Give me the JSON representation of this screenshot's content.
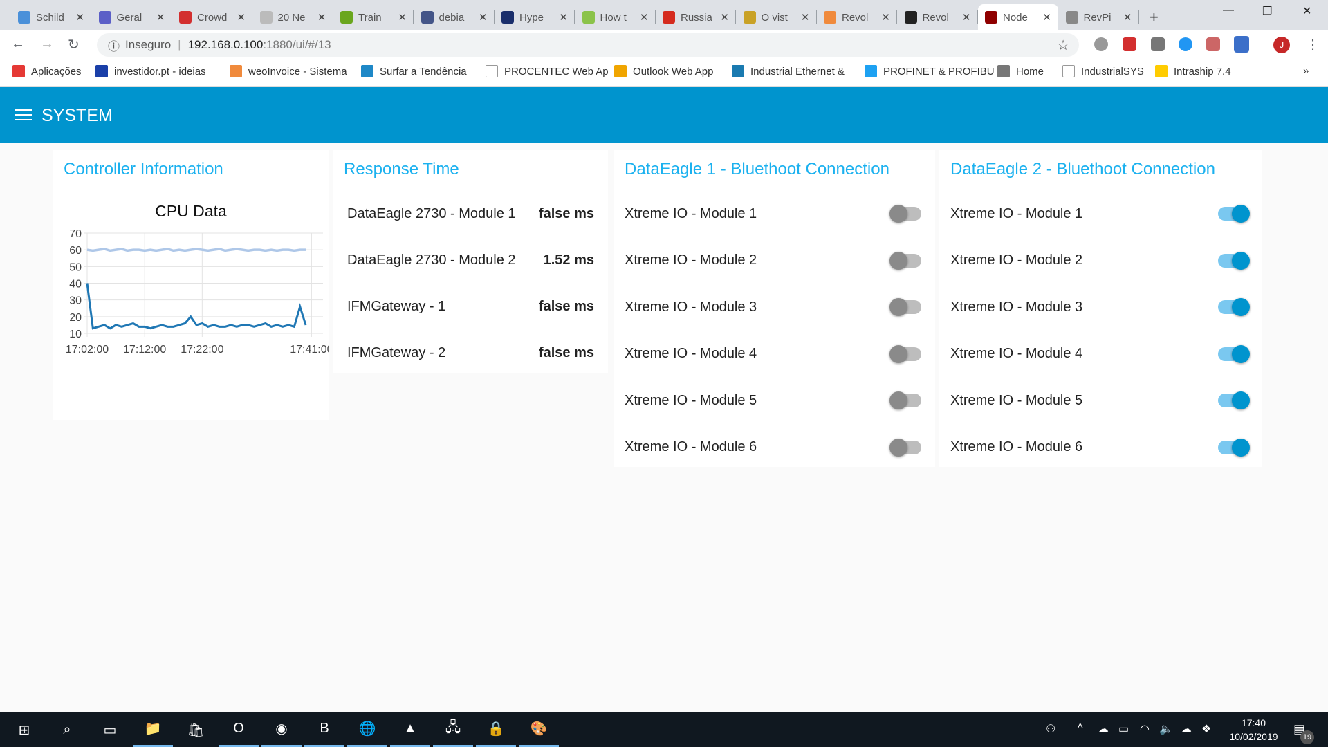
{
  "browser": {
    "tabs": [
      {
        "title": "Schild",
        "color": "#4a90d9"
      },
      {
        "title": "Geral",
        "color": "#5b5fc7"
      },
      {
        "title": "Crowd",
        "color": "#d32f2f"
      },
      {
        "title": "20 Ne",
        "color": "#bbbbbb"
      },
      {
        "title": "Train",
        "color": "#6aa61e"
      },
      {
        "title": "debia",
        "color": "#445588"
      },
      {
        "title": "Hype",
        "color": "#1a2e6b"
      },
      {
        "title": "How t",
        "color": "#8bc34a"
      },
      {
        "title": "Russia",
        "color": "#d52b1e"
      },
      {
        "title": "O vist",
        "color": "#c9a227"
      },
      {
        "title": "Revol",
        "color": "#f08a3c"
      },
      {
        "title": "Revol",
        "color": "#222222"
      },
      {
        "title": "Node",
        "color": "#8f0000",
        "active": true
      },
      {
        "title": "RevPi",
        "color": "#888888"
      }
    ],
    "new_tab": "+",
    "window_controls": {
      "minimize": "—",
      "maximize": "❐",
      "close": "✕"
    },
    "security_label": "Inseguro",
    "url_host": "192.168.0.100",
    "url_rest": ":1880/ui/#/13",
    "profile_initial": "J",
    "bookmarks": [
      {
        "label": "Aplicações",
        "color": "#e53935"
      },
      {
        "label": "investidor.pt - ideias",
        "color": "#1a3fa8"
      },
      {
        "label": "weoInvoice - Sistema",
        "color": "#f08a3c"
      },
      {
        "label": "Surfar a Tendência",
        "color": "#1e88c7"
      },
      {
        "label": "PROCENTEC Web Ap",
        "color": "#ffffff"
      },
      {
        "label": "Outlook Web App",
        "color": "#f0a500"
      },
      {
        "label": "Industrial Ethernet &",
        "color": "#1a7ab0"
      },
      {
        "label": "PROFINET & PROFIBU",
        "color": "#1da1f2"
      },
      {
        "label": "Home",
        "color": "#777777"
      },
      {
        "label": "IndustrialSYS",
        "color": "#ffffff"
      },
      {
        "label": "Intraship 7.4",
        "color": "#ffcc00"
      }
    ],
    "more_bookmarks": "»"
  },
  "header": {
    "title": "SYSTEM",
    "color": "#0094ce"
  },
  "controller": {
    "title": "Controller Information",
    "chart_data": {
      "type": "line",
      "title": "CPU Data",
      "ylim": [
        10,
        70
      ],
      "yticks": [
        "70",
        "60",
        "50",
        "40",
        "30",
        "20",
        "10"
      ],
      "xticks": [
        "17:02:00",
        "17:12:00",
        "17:22:00",
        "17:41:00"
      ],
      "grid": true,
      "x": [
        "17:02",
        "17:03",
        "17:04",
        "17:05",
        "17:06",
        "17:07",
        "17:08",
        "17:09",
        "17:10",
        "17:11",
        "17:12",
        "17:13",
        "17:14",
        "17:15",
        "17:16",
        "17:17",
        "17:18",
        "17:19",
        "17:20",
        "17:21",
        "17:22",
        "17:23",
        "17:24",
        "17:25",
        "17:26",
        "17:27",
        "17:28",
        "17:29",
        "17:30",
        "17:31",
        "17:32",
        "17:33",
        "17:34",
        "17:35",
        "17:36",
        "17:37",
        "17:38",
        "17:39",
        "17:40"
      ],
      "series": [
        {
          "color": "#aec7e8",
          "values": [
            60,
            59.5,
            60,
            60.5,
            59.5,
            60,
            60.5,
            59.5,
            60,
            60,
            59.5,
            60,
            59.5,
            60,
            60.5,
            59.5,
            60,
            59.5,
            60,
            60.5,
            60,
            59.5,
            60,
            60.5,
            59.5,
            60,
            60.5,
            60,
            59.5,
            60,
            60,
            59.5,
            60,
            59.5,
            60,
            60,
            59.5,
            60,
            60
          ]
        },
        {
          "color": "#1f77b4",
          "values": [
            40,
            13,
            14,
            15,
            13,
            15,
            14,
            15,
            16,
            14,
            14,
            13,
            14,
            15,
            14,
            14,
            15,
            16,
            20,
            15,
            16,
            14,
            15,
            14,
            14,
            15,
            14,
            15,
            15,
            14,
            15,
            16,
            14,
            15,
            14,
            15,
            14,
            26,
            15
          ]
        }
      ]
    }
  },
  "response": {
    "title": "Response Time",
    "rows": [
      {
        "label": "DataEagle 2730 - Module 1",
        "value": "false ms"
      },
      {
        "label": "DataEagle 2730 - Module 2",
        "value": "1.52 ms"
      },
      {
        "label": "IFMGateway - 1",
        "value": "false ms"
      },
      {
        "label": "IFMGateway - 2",
        "value": "false ms"
      }
    ]
  },
  "dataeagle1": {
    "title": "DataEagle 1 - Bluethoot Connection",
    "rows": [
      {
        "label": "Xtreme IO - Module 1",
        "on": false
      },
      {
        "label": "Xtreme IO - Module 2",
        "on": false
      },
      {
        "label": "Xtreme IO - Module 3",
        "on": false
      },
      {
        "label": "Xtreme IO - Module 4",
        "on": false
      },
      {
        "label": "Xtreme IO - Module 5",
        "on": false
      },
      {
        "label": "Xtreme IO - Module 6",
        "on": false
      }
    ]
  },
  "dataeagle2": {
    "title": "DataEagle 2 - Bluethoot Connection",
    "rows": [
      {
        "label": "Xtreme IO - Module 1",
        "on": true
      },
      {
        "label": "Xtreme IO - Module 2",
        "on": true
      },
      {
        "label": "Xtreme IO - Module 3",
        "on": true
      },
      {
        "label": "Xtreme IO - Module 4",
        "on": true
      },
      {
        "label": "Xtreme IO - Module 5",
        "on": true
      },
      {
        "label": "Xtreme IO - Module 6",
        "on": true
      }
    ]
  },
  "taskbar": {
    "apps": [
      {
        "name": "start",
        "glyph": "⊞"
      },
      {
        "name": "search",
        "glyph": "⌕"
      },
      {
        "name": "task-view",
        "glyph": "▭"
      },
      {
        "name": "file-explorer",
        "glyph": "📁",
        "open": true
      },
      {
        "name": "store",
        "glyph": "🛍"
      },
      {
        "name": "outlook",
        "glyph": "O",
        "open": true
      },
      {
        "name": "chrome",
        "glyph": "◉",
        "open": true
      },
      {
        "name": "b-app",
        "glyph": "B",
        "open": true
      },
      {
        "name": "globe-app",
        "glyph": "🌐",
        "open": true
      },
      {
        "name": "photos",
        "glyph": "▲",
        "open": true
      },
      {
        "name": "network-app",
        "glyph": "🖧",
        "open": true
      },
      {
        "name": "vpn-app",
        "glyph": "🔒",
        "open": true
      },
      {
        "name": "paint-app",
        "glyph": "🎨",
        "open": true
      }
    ],
    "time": "17:40",
    "date": "10/02/2019",
    "notifications": "19"
  }
}
